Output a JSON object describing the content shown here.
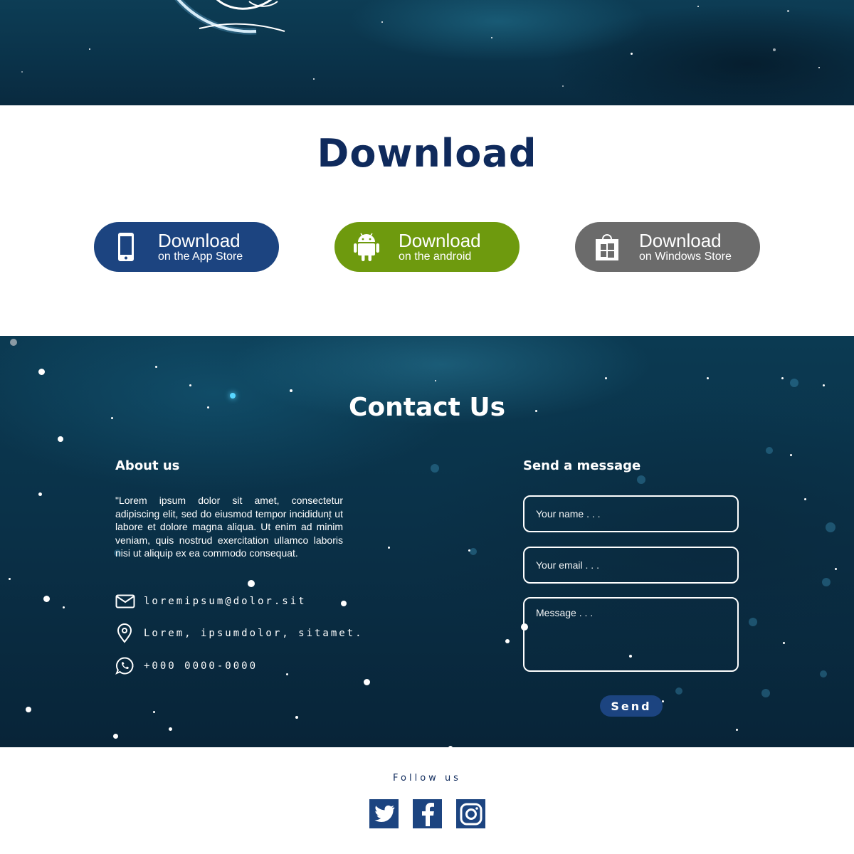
{
  "colors": {
    "navy": "#1c4480",
    "title_navy": "#0f2a5c",
    "android_green": "#6e9a0e",
    "windows_gray": "#6b6b6b",
    "space_dark": "#0a3148"
  },
  "download": {
    "title": "Download",
    "buttons": [
      {
        "icon": "phone-icon",
        "label": "Download",
        "sub": "on the App Store"
      },
      {
        "icon": "android-icon",
        "label": "Download",
        "sub": "on the android"
      },
      {
        "icon": "windows-store-icon",
        "label": "Download",
        "sub": "on Windows Store"
      }
    ]
  },
  "contact": {
    "title": "Contact Us",
    "about": {
      "heading": "About us",
      "text": "\"Lorem ipsum dolor sit amet, consectetur adipiscing elit, sed do eiusmod tempor incididunt ut labore et dolore magna aliqua. Ut enim ad minim veniam, quis nostrud exercitation ullamco laboris nisi ut aliquip ex ea commodo consequat.",
      "email": "loremipsum@dolor.sit",
      "address": "Lorem, ipsumdolor, sitamet.",
      "phone": "+000 0000-0000"
    },
    "form": {
      "heading": "Send a message",
      "name_placeholder": "Your name . . .",
      "email_placeholder": "Your email . . .",
      "message_placeholder": "Message . . .",
      "send_label": "Send"
    }
  },
  "footer": {
    "follow_label": "Follow us",
    "social": [
      "twitter-icon",
      "facebook-icon",
      "instagram-icon"
    ]
  }
}
